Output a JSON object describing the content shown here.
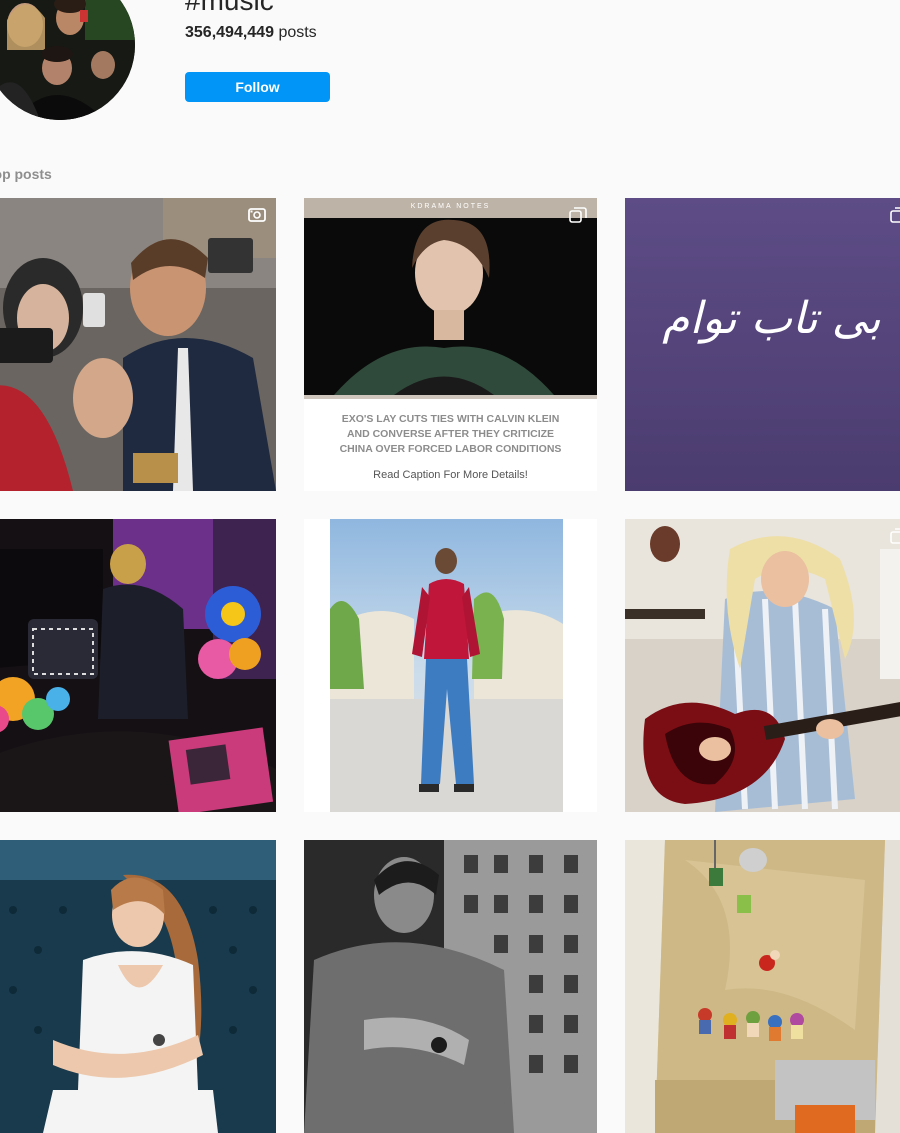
{
  "header": {
    "hashtag": "#music",
    "post_count": "356,494,449",
    "posts_word": "posts",
    "follow_label": "Follow"
  },
  "section": {
    "label": "Top posts"
  },
  "posts": [
    {
      "type": "video"
    },
    {
      "type": "carousel",
      "source_label": "KDRAMA NOTES",
      "headline_1": "EXO'S LAY CUTS TIES WITH CALVIN KLEIN",
      "headline_2": "AND CONVERSE AFTER THEY CRITICIZE",
      "headline_3": "CHINA OVER FORCED LABOR CONDITIONS",
      "footer": "Read Caption For More Details!"
    },
    {
      "type": "carousel",
      "calligraphy": "بی تاب توام"
    },
    {
      "type": "image"
    },
    {
      "type": "image"
    },
    {
      "type": "carousel"
    },
    {
      "type": "image"
    },
    {
      "type": "image"
    },
    {
      "type": "image"
    }
  ],
  "colors": {
    "follow": "#0095f6",
    "background": "#fafafa",
    "text": "#262626",
    "muted": "#8e8e8e"
  }
}
